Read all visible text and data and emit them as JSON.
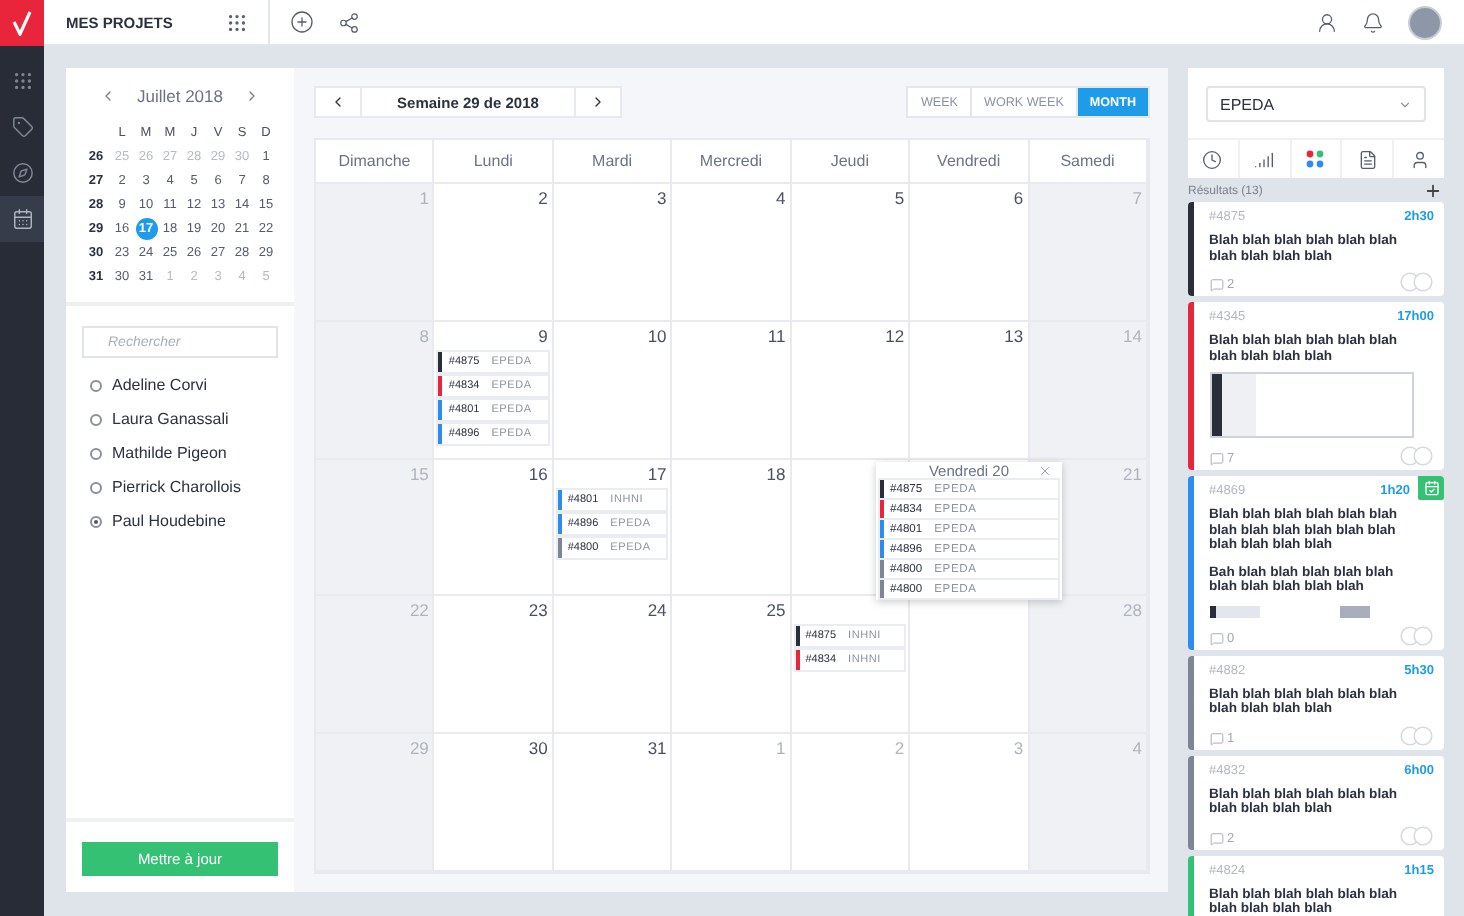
{
  "sidebar_nav": [
    {
      "selected": false
    },
    {
      "selected": false
    },
    {
      "selected": false
    },
    {
      "selected": true
    }
  ],
  "top_bar": {
    "title": "MES PROJETS"
  },
  "mini_calendar": {
    "month": "Juillet 2018",
    "weekdays": [
      "L",
      "M",
      "M",
      "J",
      "V",
      "S",
      "D"
    ],
    "weeks": [
      {
        "number": "26",
        "days": [
          {
            "d": "25",
            "muted": true,
            "selected": false
          },
          {
            "d": "26",
            "muted": true,
            "selected": false
          },
          {
            "d": "27",
            "muted": true,
            "selected": false
          },
          {
            "d": "28",
            "muted": true,
            "selected": false
          },
          {
            "d": "29",
            "muted": true,
            "selected": false
          },
          {
            "d": "30",
            "muted": true,
            "selected": false
          },
          {
            "d": "1",
            "muted": false,
            "selected": false
          }
        ]
      },
      {
        "number": "27",
        "days": [
          {
            "d": "2",
            "muted": false,
            "selected": false
          },
          {
            "d": "3",
            "muted": false,
            "selected": false
          },
          {
            "d": "4",
            "muted": false,
            "selected": false
          },
          {
            "d": "5",
            "muted": false,
            "selected": false
          },
          {
            "d": "6",
            "muted": false,
            "selected": false
          },
          {
            "d": "7",
            "muted": false,
            "selected": false
          },
          {
            "d": "8",
            "muted": false,
            "selected": false
          }
        ]
      },
      {
        "number": "28",
        "days": [
          {
            "d": "9",
            "muted": false,
            "selected": false
          },
          {
            "d": "10",
            "muted": false,
            "selected": false
          },
          {
            "d": "11",
            "muted": false,
            "selected": false
          },
          {
            "d": "12",
            "muted": false,
            "selected": false
          },
          {
            "d": "13",
            "muted": false,
            "selected": false
          },
          {
            "d": "14",
            "muted": false,
            "selected": false
          },
          {
            "d": "15",
            "muted": false,
            "selected": false
          }
        ]
      },
      {
        "number": "29",
        "days": [
          {
            "d": "16",
            "muted": false,
            "selected": false
          },
          {
            "d": "17",
            "muted": false,
            "selected": true
          },
          {
            "d": "18",
            "muted": false,
            "selected": false
          },
          {
            "d": "19",
            "muted": false,
            "selected": false
          },
          {
            "d": "20",
            "muted": false,
            "selected": false
          },
          {
            "d": "21",
            "muted": false,
            "selected": false
          },
          {
            "d": "22",
            "muted": false,
            "selected": false
          }
        ]
      },
      {
        "number": "30",
        "days": [
          {
            "d": "23",
            "muted": false,
            "selected": false
          },
          {
            "d": "24",
            "muted": false,
            "selected": false
          },
          {
            "d": "25",
            "muted": false,
            "selected": false
          },
          {
            "d": "26",
            "muted": false,
            "selected": false
          },
          {
            "d": "27",
            "muted": false,
            "selected": false
          },
          {
            "d": "28",
            "muted": false,
            "selected": false
          },
          {
            "d": "29",
            "muted": false,
            "selected": false
          }
        ]
      },
      {
        "number": "31",
        "days": [
          {
            "d": "30",
            "muted": false,
            "selected": false
          },
          {
            "d": "31",
            "muted": false,
            "selected": false
          },
          {
            "d": "1",
            "muted": true,
            "selected": false
          },
          {
            "d": "2",
            "muted": true,
            "selected": false
          },
          {
            "d": "3",
            "muted": true,
            "selected": false
          },
          {
            "d": "4",
            "muted": true,
            "selected": false
          },
          {
            "d": "5",
            "muted": true,
            "selected": false
          }
        ]
      }
    ]
  },
  "search": {
    "placeholder": "Rechercher"
  },
  "people": [
    {
      "name": "Adeline Corvi",
      "selected": false
    },
    {
      "name": "Laura Ganassali",
      "selected": false
    },
    {
      "name": "Mathilde Pigeon",
      "selected": false
    },
    {
      "name": "Pierrick Charollois",
      "selected": false
    },
    {
      "name": "Paul Houdebine",
      "selected": true
    }
  ],
  "update_button": "Mettre à jour",
  "calendar": {
    "title": "Semaine 29 de 2018",
    "views": [
      {
        "label": "WEEK",
        "selected": false
      },
      {
        "label": "WORK WEEK",
        "selected": false
      },
      {
        "label": "MONTH",
        "selected": true
      }
    ],
    "columns": [
      "Dimanche",
      "Lundi",
      "Mardi",
      "Mercredi",
      "Jeudi",
      "Vendredi",
      "Samedi"
    ],
    "weeks": [
      {
        "days": [
          {
            "day": "1",
            "weekend": true,
            "muted": true
          },
          {
            "day": "2",
            "weekend": false,
            "muted": false
          },
          {
            "day": "3",
            "weekend": false,
            "muted": false
          },
          {
            "day": "4",
            "weekend": false,
            "muted": false
          },
          {
            "day": "5",
            "weekend": false,
            "muted": false
          },
          {
            "day": "6",
            "weekend": false,
            "muted": false
          },
          {
            "day": "7",
            "weekend": true,
            "muted": true
          }
        ]
      },
      {
        "days": [
          {
            "day": "8",
            "weekend": true,
            "muted": true
          },
          {
            "day": "9",
            "weekend": false,
            "muted": false,
            "events": [
              {
                "id": "#4875",
                "project": "EPEDA",
                "color": "#2a2e38"
              },
              {
                "id": "#4834",
                "project": "EPEDA",
                "color": "#e8253a"
              },
              {
                "id": "#4801",
                "project": "EPEDA",
                "color": "#2d8cf0"
              },
              {
                "id": "#4896",
                "project": "EPEDA",
                "color": "#2d8cf0"
              }
            ]
          },
          {
            "day": "10",
            "weekend": false,
            "muted": false
          },
          {
            "day": "11",
            "weekend": false,
            "muted": false
          },
          {
            "day": "12",
            "weekend": false,
            "muted": false
          },
          {
            "day": "13",
            "weekend": false,
            "muted": false
          },
          {
            "day": "14",
            "weekend": true,
            "muted": true
          }
        ]
      },
      {
        "days": [
          {
            "day": "15",
            "weekend": true,
            "muted": true
          },
          {
            "day": "16",
            "weekend": false,
            "muted": false
          },
          {
            "day": "17",
            "weekend": false,
            "muted": false,
            "events": [
              {
                "id": "#4801",
                "project": "INHNI",
                "color": "#2d8cf0"
              },
              {
                "id": "#4896",
                "project": "EPEDA",
                "color": "#2d8cf0"
              },
              {
                "id": "#4800",
                "project": "EPEDA",
                "color": "#7d8697"
              }
            ]
          },
          {
            "day": "18",
            "weekend": false,
            "muted": false
          },
          {
            "weekend": false
          },
          {
            "weekend": false
          },
          {
            "day": "21",
            "weekend": true,
            "muted": true
          }
        ]
      },
      {
        "days": [
          {
            "day": "22",
            "weekend": true,
            "muted": true
          },
          {
            "day": "23",
            "weekend": false,
            "muted": false
          },
          {
            "day": "24",
            "weekend": false,
            "muted": false
          },
          {
            "day": "25",
            "weekend": false,
            "muted": false
          },
          {
            "weekend": false,
            "events": [
              {
                "id": "#4875",
                "project": "INHNI",
                "color": "#2a2e38"
              },
              {
                "id": "#4834",
                "project": "INHNI",
                "color": "#e8253a"
              }
            ]
          },
          {
            "weekend": false
          },
          {
            "day": "28",
            "weekend": true,
            "muted": true
          }
        ]
      },
      {
        "days": [
          {
            "day": "29",
            "weekend": true,
            "muted": true
          },
          {
            "day": "30",
            "weekend": false,
            "muted": false
          },
          {
            "day": "31",
            "weekend": false,
            "muted": false
          },
          {
            "day": "1",
            "weekend": false,
            "muted": true
          },
          {
            "day": "2",
            "weekend": false,
            "muted": true
          },
          {
            "day": "3",
            "weekend": false,
            "muted": true
          },
          {
            "day": "4",
            "weekend": true,
            "muted": true
          }
        ]
      }
    ],
    "popover": {
      "title": "Vendredi 20",
      "events": [
        {
          "id": "#4875",
          "project": "EPEDA",
          "color": "#2a2e38"
        },
        {
          "id": "#4834",
          "project": "EPEDA",
          "color": "#e8253a"
        },
        {
          "id": "#4801",
          "project": "EPEDA",
          "color": "#2d8cf0"
        },
        {
          "id": "#4896",
          "project": "EPEDA",
          "color": "#2d8cf0"
        },
        {
          "id": "#4800",
          "project": "EPEDA",
          "color": "#7d8697"
        },
        {
          "id": "#4800",
          "project": "EPEDA",
          "color": "#7d8697"
        }
      ]
    }
  },
  "results": {
    "filter": "EPEDA",
    "title": "Résultats (13)",
    "cards": [
      {
        "id": "#4875",
        "time": "2h30",
        "color": "#2a2e38",
        "scheduled": false,
        "paragraphs": [
          "Blah blah blah blah blah blah blah blah blah blah"
        ],
        "comments": "2"
      },
      {
        "id": "#4345",
        "time": "17h00",
        "color": "#e8253a",
        "scheduled": false,
        "paragraphs": [
          "Blah blah blah blah blah blah blah blah blah blah"
        ],
        "attachment": {
          "kind": "screenshot"
        },
        "comments": "7"
      },
      {
        "id": "#4869",
        "time": "1h20",
        "color": "#2d8cf0",
        "scheduled": true,
        "paragraphs": [
          "Blah blah blah blah blah blah blah blah blah blah blah blah blah blah blah blah",
          "Bah blah blah blah blah blah blah blah blah blah blah"
        ],
        "attachment": {
          "kind": "strip"
        },
        "comments": "0"
      },
      {
        "id": "#4882",
        "time": "5h30",
        "color": "#7d8697",
        "scheduled": false,
        "paragraphs": [
          "Blah blah blah blah blah blah blah blah blah blah"
        ],
        "comments": "1"
      },
      {
        "id": "#4832",
        "time": "6h00",
        "color": "#7d8697",
        "scheduled": false,
        "paragraphs": [
          "Blah blah blah blah blah blah blah blah blah blah"
        ],
        "comments": "2"
      },
      {
        "id": "#4824",
        "time": "1h15",
        "color": "#35c174",
        "scheduled": false,
        "paragraphs": [
          "Blah blah blah blah blah blah blah blah blah blah"
        ]
      }
    ]
  }
}
